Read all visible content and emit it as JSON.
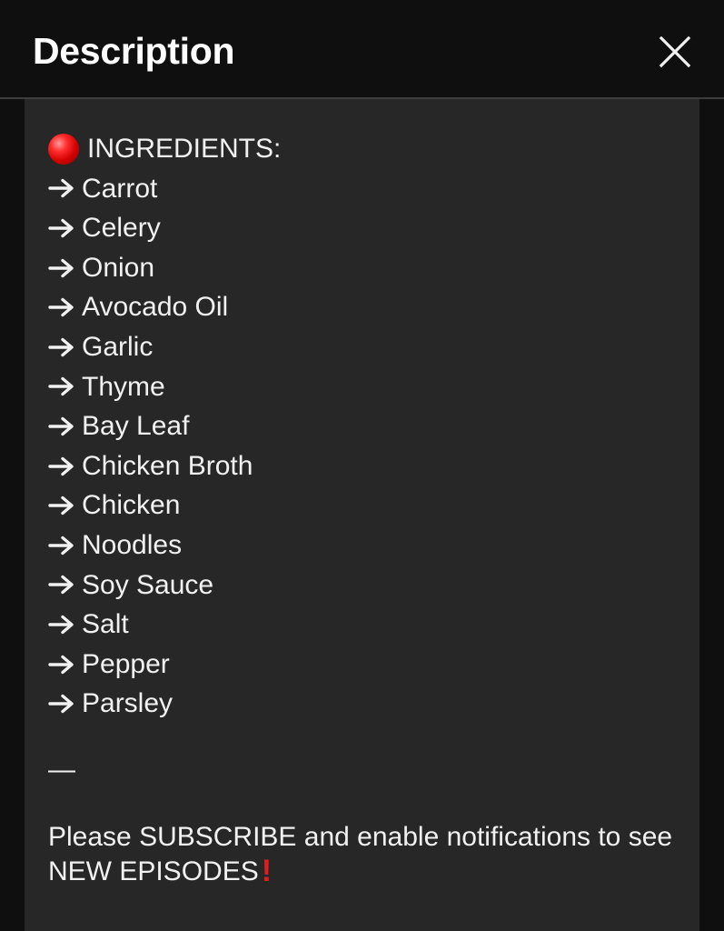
{
  "header": {
    "title": "Description",
    "close_icon": "close-icon"
  },
  "description": {
    "section_icon": "red-circle-emoji",
    "section_title": "INGREDIENTS:",
    "bullet_icon": "right-arrow-icon",
    "ingredients": [
      "Carrot",
      "Celery",
      "Onion",
      "Avocado Oil",
      "Garlic",
      "Thyme",
      "Bay Leaf",
      "Chicken Broth",
      "Chicken",
      "Noodles",
      "Soy Sauce",
      "Salt",
      "Pepper",
      "Parsley"
    ],
    "separator": "—",
    "cta_text": "Please SUBSCRIBE and enable notifications to see NEW EPISODES",
    "cta_icon": "red-exclamation-emoji",
    "cta_icon_glyph": "!"
  },
  "colors": {
    "background": "#0f0f0f",
    "panel": "#272727",
    "text": "#f1f1f1",
    "accent_red": "#e11d1d"
  }
}
